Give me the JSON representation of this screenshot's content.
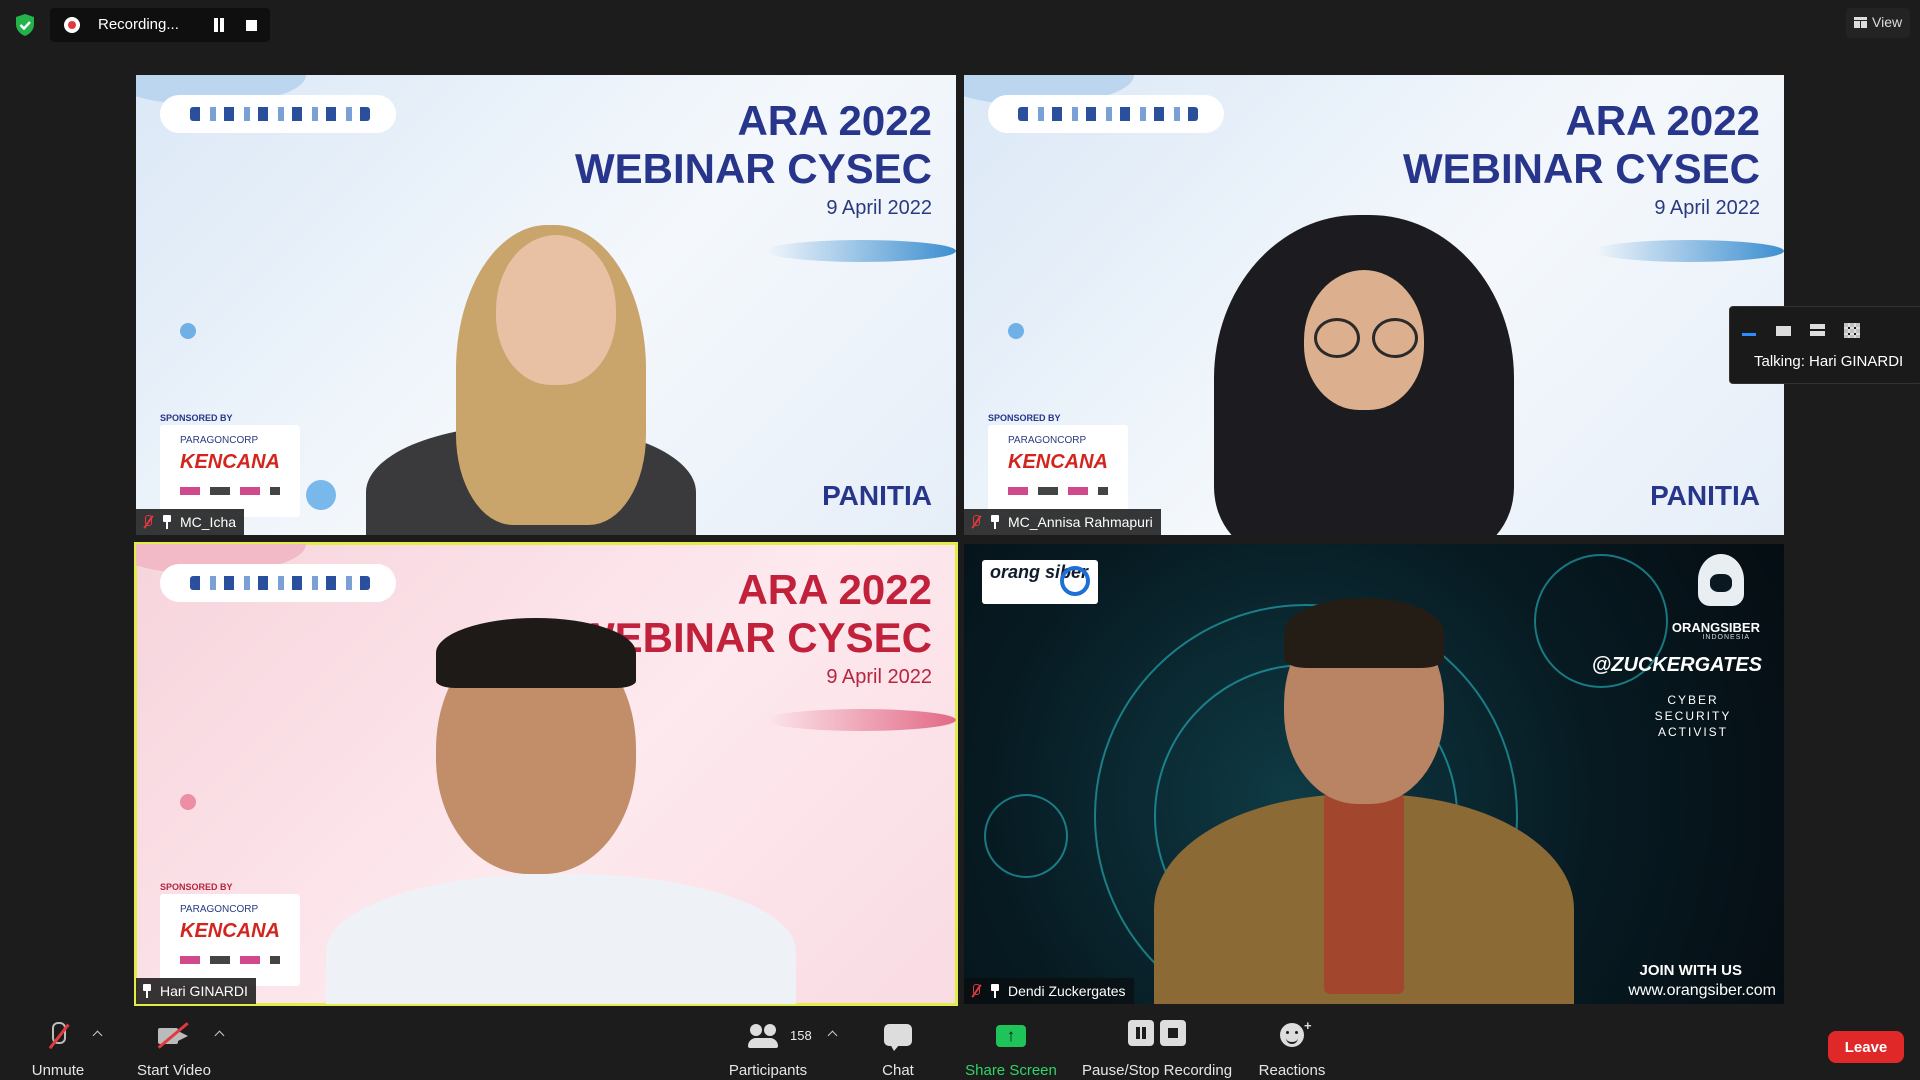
{
  "top_bar": {
    "security_icon": "shield-check-icon",
    "recording_status": "Recording...",
    "view_label": "View"
  },
  "tiles": [
    {
      "name": "MC_Icha",
      "theme": "blue",
      "title_line1": "ARA 2022",
      "title_line2": "WEBINAR CYSEC",
      "date": "9 April 2022",
      "sponsored_by": "SPONSORED BY",
      "sponsor_brand": "PARAGONCORP",
      "sponsor_main": "KENCANA",
      "footer_text": "PANITIA",
      "muted": true,
      "pinned": true
    },
    {
      "name": "MC_Annisa Rahmapuri",
      "theme": "blue",
      "title_line1": "ARA 2022",
      "title_line2": "WEBINAR CYSEC",
      "date": "9 April 2022",
      "sponsored_by": "SPONSORED BY",
      "sponsor_brand": "PARAGONCORP",
      "sponsor_main": "KENCANA",
      "footer_text": "PANITIA",
      "muted": true,
      "pinned": true
    },
    {
      "name": "Hari GINARDI",
      "theme": "pink",
      "title_line1": "ARA 2022",
      "title_line2": "WEBINAR CYSEC",
      "date": "9 April 2022",
      "sponsored_by": "SPONSORED BY",
      "sponsor_brand": "PARAGONCORP",
      "sponsor_main": "KENCANA",
      "active_speaker": true,
      "muted": false,
      "pinned": true
    },
    {
      "name": "Dendi Zuckergates",
      "theme": "cyber",
      "brand_logo": "orang siber",
      "org_logo": "ORANGSIBER",
      "org_sub": "INDONESIA",
      "handle": "@ZUCKERGATES",
      "role": "CYBER SECURITY ACTIVIST",
      "join_text": "JOIN WITH US",
      "website": "www.orangsiber.com",
      "muted": true,
      "pinned": true
    }
  ],
  "layout_popup": {
    "talking": "Talking: Hari GINARDI",
    "selected_layout": "minimize"
  },
  "toolbar": {
    "unmute": "Unmute",
    "start_video": "Start Video",
    "participants_label": "Participants",
    "participants_count": "158",
    "chat": "Chat",
    "share_screen": "Share Screen",
    "record": "Pause/Stop Recording",
    "reactions": "Reactions",
    "leave": "Leave"
  },
  "colors": {
    "background": "#1c1c1c",
    "active_speaker_border": "#e4ec4a",
    "share_green": "#2fd565",
    "leave_red": "#e02828",
    "muted_red": "#e0393e"
  }
}
